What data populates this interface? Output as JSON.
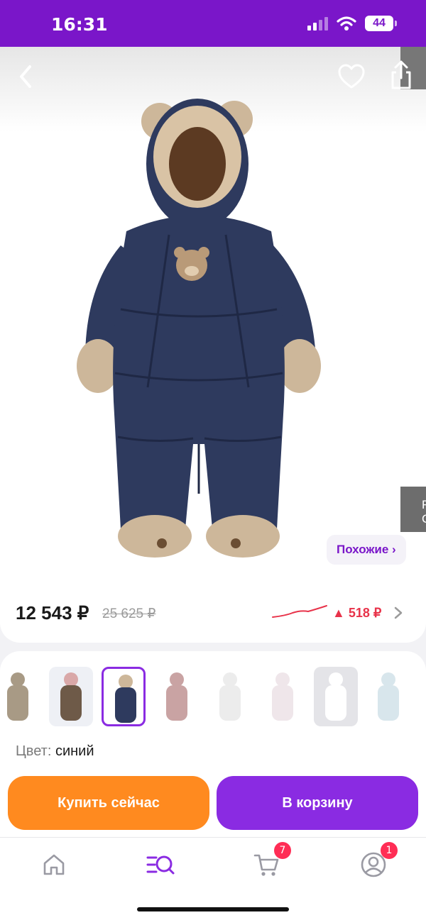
{
  "status": {
    "time": "16:31",
    "battery": "44"
  },
  "hero": {
    "similar_label": "Похожие ›",
    "side_tab_text": "F\nC"
  },
  "pricing": {
    "price": "12 543 ₽",
    "old_price": "25 625 ₽",
    "delta": "▲ 518 ₽"
  },
  "variants": {
    "color_label": "Цвет:",
    "color_value": "синий",
    "items": [
      {
        "color": "#a89a85"
      },
      {
        "color": "#6e5a48"
      },
      {
        "color": "#2e3a5e"
      },
      {
        "color": "#c9a3a3"
      },
      {
        "color": "#ececec"
      },
      {
        "color": "#efe6ea"
      },
      {
        "color": "#e9e9ee"
      },
      {
        "color": "#d8e6ec"
      }
    ]
  },
  "actions": {
    "buy_now": "Купить сейчас",
    "add_to_cart": "В корзину"
  },
  "tabbar": {
    "cart_badge": "7",
    "profile_badge": "1"
  },
  "colors": {
    "brand_purple": "#7a16c9",
    "accent_orange": "#ff8a1f",
    "button_purple": "#8a2be2",
    "price_down_red": "#e8334a"
  }
}
